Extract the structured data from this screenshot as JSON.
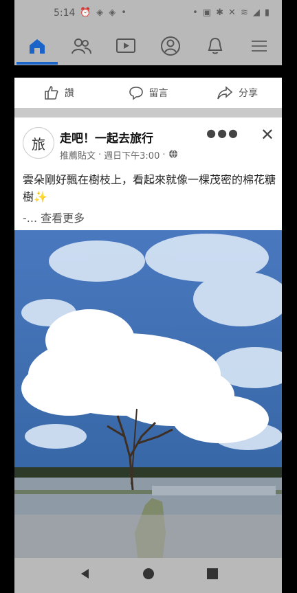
{
  "status": {
    "time": "5:14"
  },
  "nav": {
    "items": [
      "home",
      "friends",
      "watch",
      "profile",
      "notifications",
      "menu"
    ]
  },
  "actions": {
    "like": "讚",
    "comment": "留言",
    "share": "分享"
  },
  "post": {
    "page_name": "走吧！一起去旅行",
    "meta_label": "推薦貼文",
    "time": "週日下午3:00",
    "text_line": "雲朵剛好飄在樹枝上，看起來就像一棵茂密的棉花糖樹✨",
    "see_more": "-... 查看更多",
    "avatar_text": "旅"
  },
  "colors": {
    "accent": "#1877f2",
    "gray": "#b9b9b9",
    "bg": "#000000"
  }
}
